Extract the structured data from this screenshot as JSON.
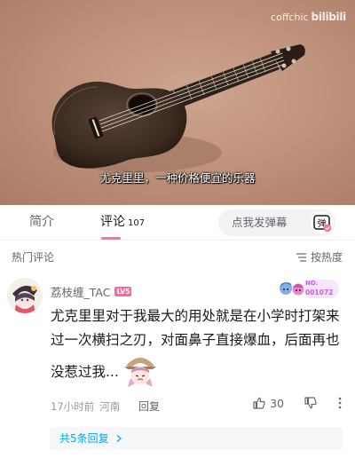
{
  "video": {
    "watermark_text": "coffchic",
    "watermark_brand": "bilibili",
    "subtitle": "尤克里里，一种价格便宜的乐器"
  },
  "tabs": {
    "intro_label": "简介",
    "comments_label": "评论",
    "comments_count": "107"
  },
  "danmaku": {
    "placeholder": "点我发弹幕",
    "button_glyph": "弹"
  },
  "section": {
    "title": "热门评论",
    "sort_label": "按热度"
  },
  "comment": {
    "username": "荔枝缠_TAC",
    "level": "LV5",
    "fan_badge_no": "NO.",
    "fan_badge_number": "001072",
    "text": "尤克里里对于我最大的用处就是在小学时打架来过一次横扫之刃，对面鼻子直接爆血，后面再也没惹过我...",
    "time": "17小时前",
    "location": "河南",
    "reply_label": "回复",
    "likes": "30",
    "replies_link": "共5条回复"
  },
  "icons": {
    "like": "thumb-up-icon",
    "dislike": "thumb-down-icon",
    "more": "more-vertical-icon",
    "sort": "sort-icon",
    "chevron": "chevron-right-icon"
  },
  "colors": {
    "accent_pink": "#fb7299",
    "link_blue": "#00aeec",
    "level_badge": "#ff6699"
  }
}
